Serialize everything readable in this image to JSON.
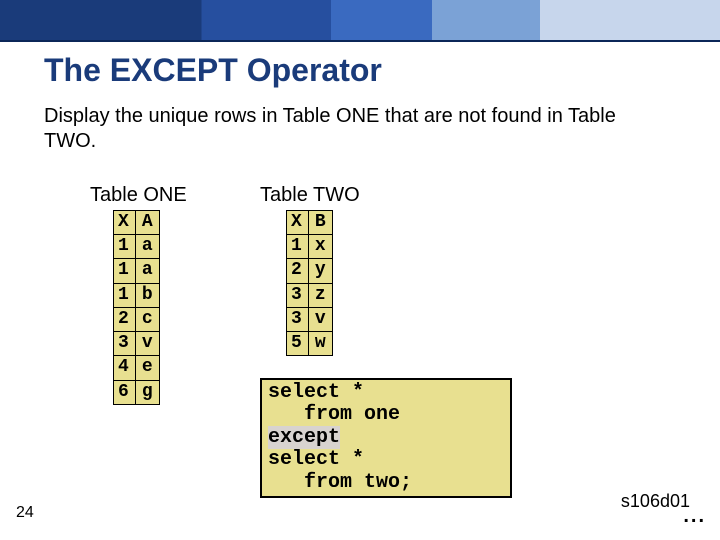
{
  "title": "The EXCEPT Operator",
  "description": "Display the unique rows in Table ONE that are not found in Table TWO.",
  "tables": {
    "one": {
      "label": "Table ONE",
      "rows": [
        [
          "X",
          "A"
        ],
        [
          "1",
          "a"
        ],
        [
          "1",
          "a"
        ],
        [
          "1",
          "b"
        ],
        [
          "2",
          "c"
        ],
        [
          "3",
          "v"
        ],
        [
          "4",
          "e"
        ],
        [
          "6",
          "g"
        ]
      ]
    },
    "two": {
      "label": "Table TWO",
      "rows": [
        [
          "X",
          "B"
        ],
        [
          "1",
          "x"
        ],
        [
          "2",
          "y"
        ],
        [
          "3",
          "z"
        ],
        [
          "3",
          "v"
        ],
        [
          "5",
          "w"
        ]
      ]
    }
  },
  "sql": {
    "l1": "select *",
    "l2": "   from one",
    "l3": "except",
    "l4": "select *",
    "l5": "   from two;"
  },
  "page_number": "24",
  "slide_id": "s106d01",
  "dots": "..."
}
